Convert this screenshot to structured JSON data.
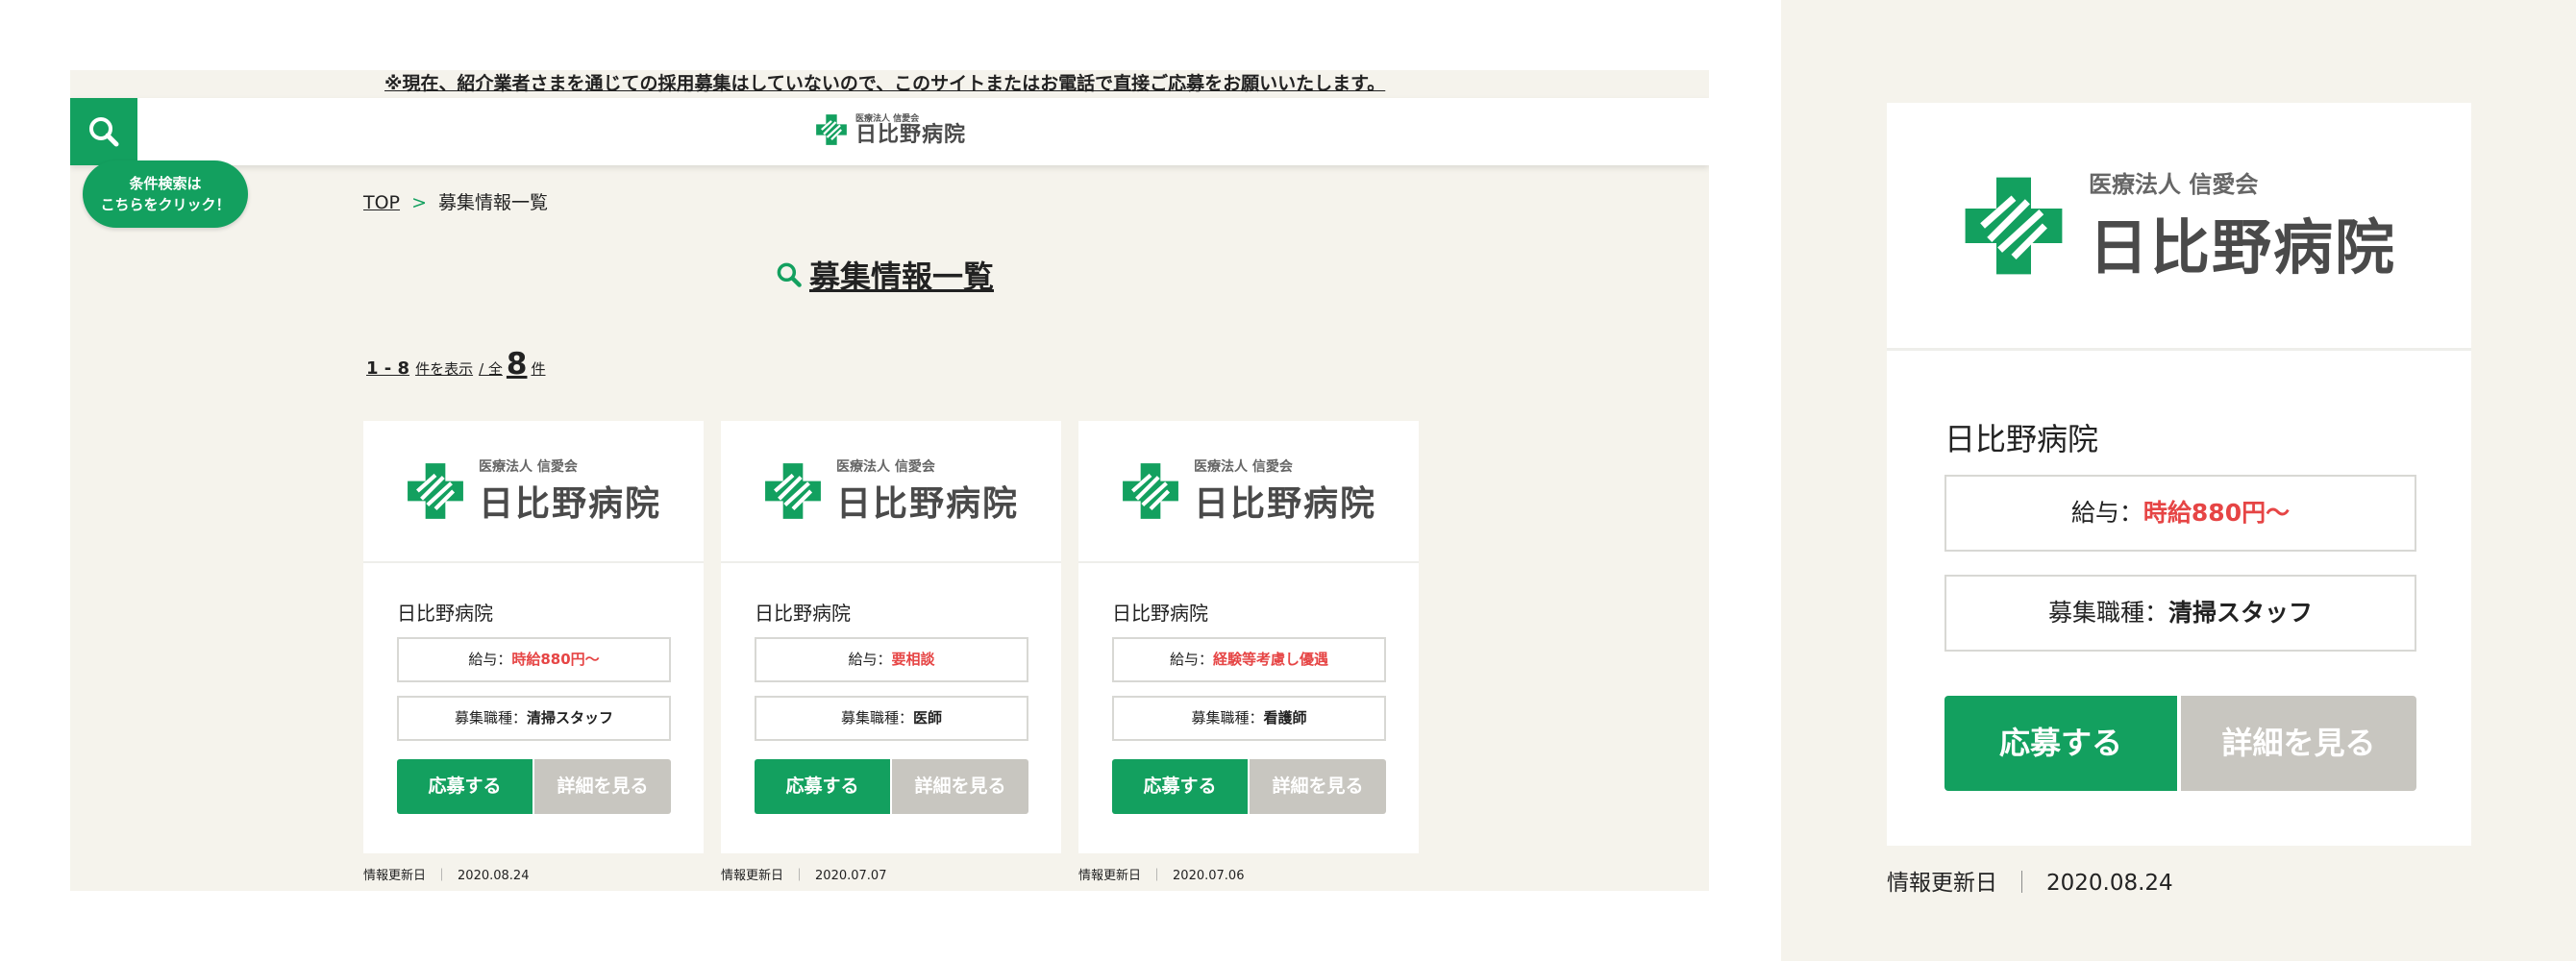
{
  "notice": "※現在、紹介業者さまを通じての採用募集はしていないので、このサイトまたはお電話で直接ご応募をお願いいたします。",
  "logo": {
    "sub": "医療法人 信愛会",
    "main": "日比野病院"
  },
  "icons": {
    "search": "search-icon",
    "logo_mark": "green-cross-logo-icon"
  },
  "colors": {
    "accent": "#13a05f",
    "salary": "#e64545",
    "detail_button": "#c8c6c0",
    "background": "#f5f3ec"
  },
  "condition_button": {
    "line1": "条件検索は",
    "line2": "こちらをクリック！"
  },
  "breadcrumb": {
    "top": "TOP",
    "sep": ">",
    "current": "募集情報一覧"
  },
  "title": "募集情報一覧",
  "count": {
    "range": "1 - 8",
    "range_suffix": "件を表示",
    "total_prefix": "/ 全",
    "total": "8",
    "total_suffix": "件"
  },
  "labels": {
    "salary": "給与：",
    "job": "募集職種：",
    "apply": "応募する",
    "detail": "詳細を見る",
    "updated": "情報更新日",
    "bar": "｜"
  },
  "cards": [
    {
      "hospital": "日比野病院",
      "salary": "時給880円〜",
      "job": "清掃スタッフ",
      "date": "2020.08.24"
    },
    {
      "hospital": "日比野病院",
      "salary": "要相談",
      "job": "医師",
      "date": "2020.07.07"
    },
    {
      "hospital": "日比野病院",
      "salary": "経験等考慮し優遇",
      "job": "看護師",
      "date": "2020.07.06"
    }
  ],
  "zoom": {
    "hospital": "日比野病院",
    "salary": "時給880円〜",
    "job": "清掃スタッフ",
    "date": "2020.08.24"
  }
}
